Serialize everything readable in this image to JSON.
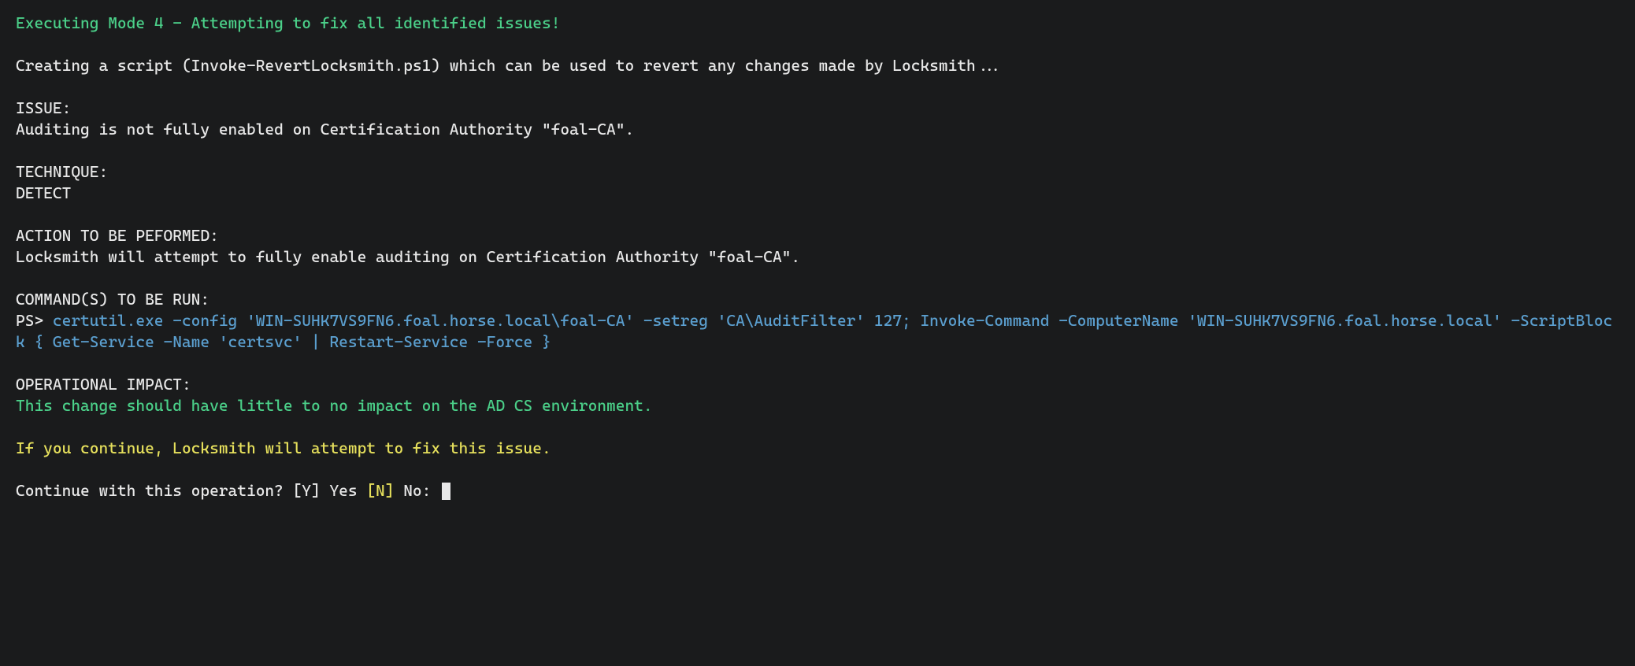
{
  "header": {
    "mode_line": "Executing Mode 4 - Attempting to fix all identified issues!"
  },
  "script_line": {
    "pre": "Creating a script (",
    "name": "Invoke-RevertLocksmith.ps1",
    "post": ") which can be used to revert any changes made by Locksmith..."
  },
  "issue": {
    "label": "ISSUE:",
    "text": "Auditing is not fully enabled on Certification Authority \"foal-CA\"."
  },
  "technique": {
    "label": "TECHNIQUE:",
    "text": "DETECT"
  },
  "action": {
    "label": "ACTION TO BE PEFORMED:",
    "text": "Locksmith will attempt to fully enable auditing on Certification Authority \"foal-CA\"."
  },
  "commands": {
    "label": "COMMAND(S) TO BE RUN:",
    "prompt": "PS> ",
    "cmd": "certutil.exe -config 'WIN-SUHK7VS9FN6.foal.horse.local\\foal-CA' -setreg 'CA\\AuditFilter' 127; Invoke-Command -ComputerName 'WIN-SUHK7VS9FN6.foal.horse.local' -ScriptBlock { Get-Service -Name 'certsvc' | Restart-Service -Force }"
  },
  "impact": {
    "label": "OPERATIONAL IMPACT:",
    "text": "This change should have little to no impact on the AD CS environment."
  },
  "warning": "If you continue, Locksmith will attempt to fix this issue.",
  "prompt": {
    "pre": "Continue with this operation? ",
    "yes_open": "[",
    "yes_letter": "Y",
    "yes_close": "]",
    "yes_word": " Yes ",
    "no_open": "[",
    "no_letter": "N",
    "no_close": "]",
    "no_word": " No: "
  }
}
